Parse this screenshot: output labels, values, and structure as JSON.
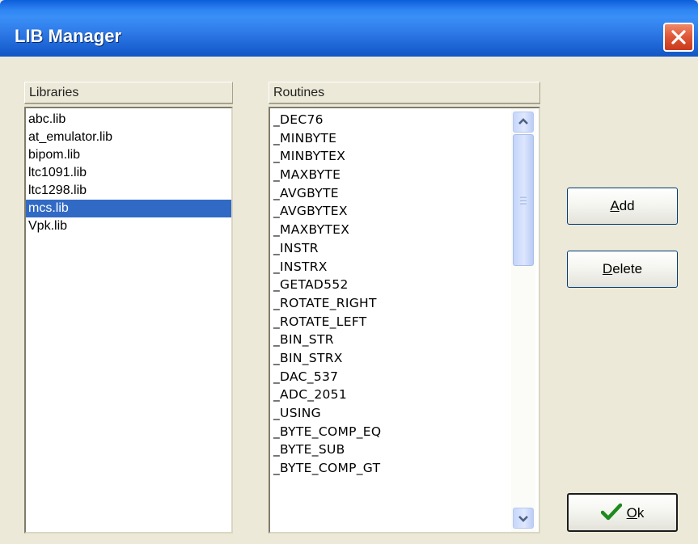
{
  "window": {
    "title": "LIB Manager",
    "close_icon": "close-icon"
  },
  "libraries": {
    "header": "Libraries",
    "items": [
      "abc.lib",
      "at_emulator.lib",
      "bipom.lib",
      "ltc1091.lib",
      "ltc1298.lib",
      "mcs.lib",
      "Vpk.lib"
    ],
    "selected": "mcs.lib"
  },
  "routines": {
    "header": "Routines",
    "items": [
      "_DEC76",
      "_MINBYTE",
      "_MINBYTEX",
      "_MAXBYTE",
      "_AVGBYTE",
      "_AVGBYTEX",
      "_MAXBYTEX",
      "_INSTR",
      "_INSTRX",
      "_GETAD552",
      "_ROTATE_RIGHT",
      "_ROTATE_LEFT",
      "_BIN_STR",
      "_BIN_STRX",
      "_DAC_537",
      "_ADC_2051",
      "_USING",
      "_BYTE_COMP_EQ",
      "_BYTE_SUB",
      "_BYTE_COMP_GT"
    ]
  },
  "buttons": {
    "add": {
      "mnemonic": "A",
      "rest": "dd"
    },
    "delete": {
      "mnemonic": "D",
      "rest": "elete"
    },
    "ok": {
      "mnemonic": "O",
      "rest": "k",
      "icon": "checkmark-icon"
    }
  },
  "colors": {
    "titlebar": "#2e86f3",
    "selection": "#316ac5",
    "face": "#ece9d8"
  }
}
